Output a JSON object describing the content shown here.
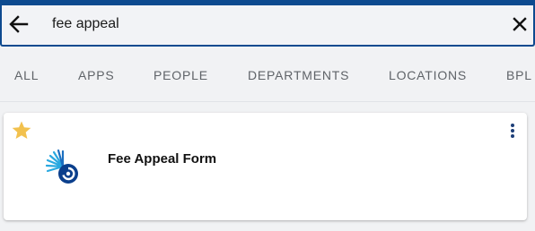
{
  "colors": {
    "brand_blue": "#0d4a8f",
    "star_gold": "#f2c14e",
    "logo_blue_light": "#29a8e0",
    "logo_blue_dark": "#0b3f8c",
    "tab_text": "#5f6368"
  },
  "search": {
    "value": "fee appeal",
    "back_icon": "arrow-left-icon",
    "clear_icon": "close-icon"
  },
  "tabs": [
    {
      "label": "ALL"
    },
    {
      "label": "APPS"
    },
    {
      "label": "PEOPLE"
    },
    {
      "label": "DEPARTMENTS"
    },
    {
      "label": "LOCATIONS"
    },
    {
      "label": "BPL"
    }
  ],
  "results": [
    {
      "title": "Fee Appeal Form",
      "favorite": true,
      "favorite_icon": "star-icon",
      "logo_icon": "nautilus-shell-logo-icon",
      "menu_icon": "more-vertical-icon"
    }
  ]
}
